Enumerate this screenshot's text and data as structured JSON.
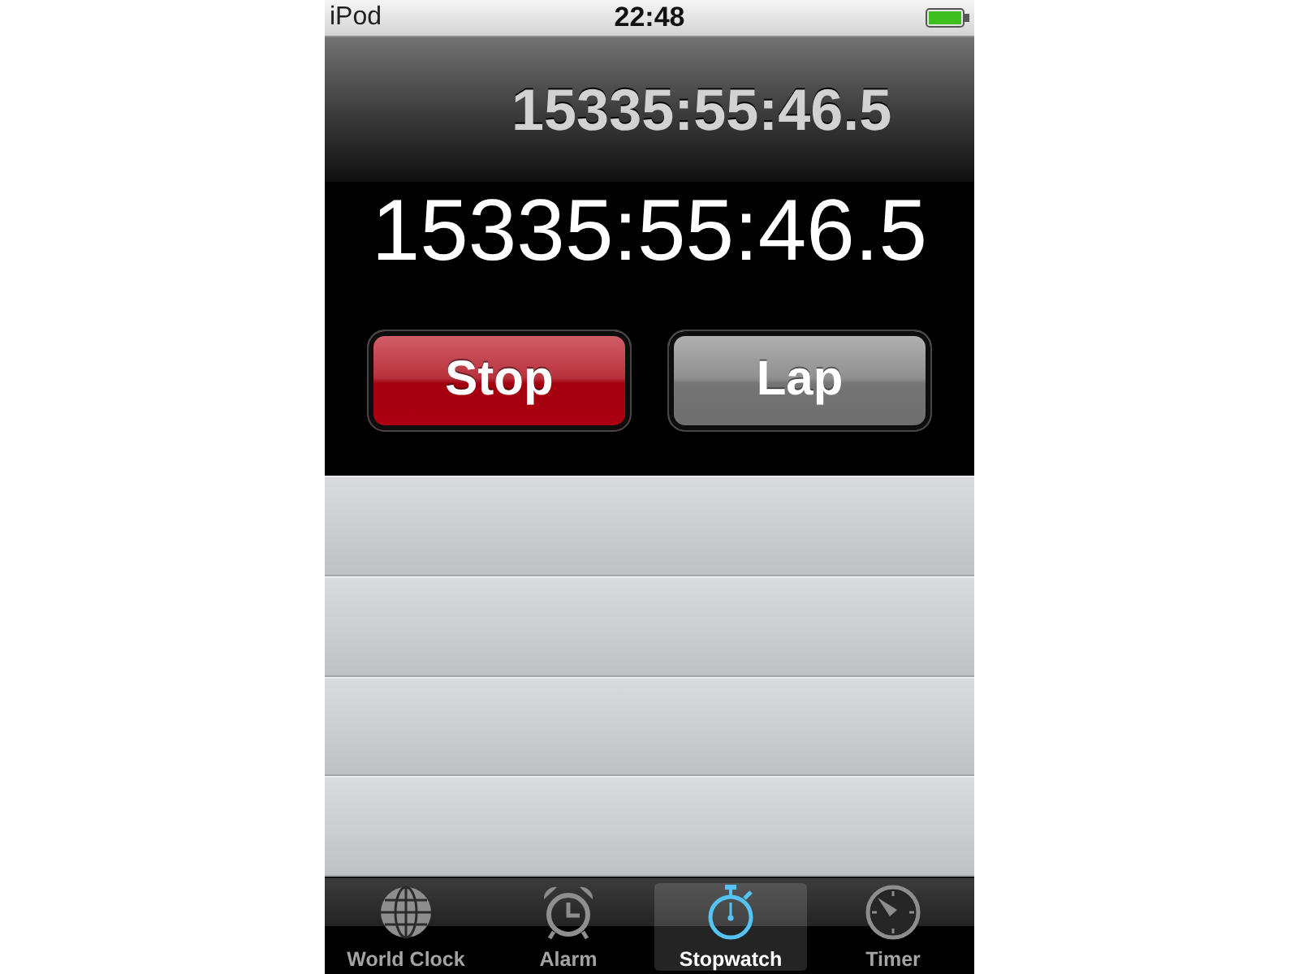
{
  "status_bar": {
    "device": "iPod",
    "time": "22:48"
  },
  "header": {
    "time": "15335:55:46.5"
  },
  "display": {
    "time": "15335:55:46.5"
  },
  "buttons": [
    {
      "label": "Stop",
      "kind": "stop"
    },
    {
      "label": "Lap",
      "kind": "lap"
    }
  ],
  "tabs": [
    {
      "label": "World Clock",
      "kind": "globe",
      "selected": false
    },
    {
      "label": "Alarm",
      "kind": "alarm",
      "selected": false
    },
    {
      "label": "Stopwatch",
      "kind": "stopwatch",
      "selected": true
    },
    {
      "label": "Timer",
      "kind": "timer",
      "selected": false
    }
  ]
}
